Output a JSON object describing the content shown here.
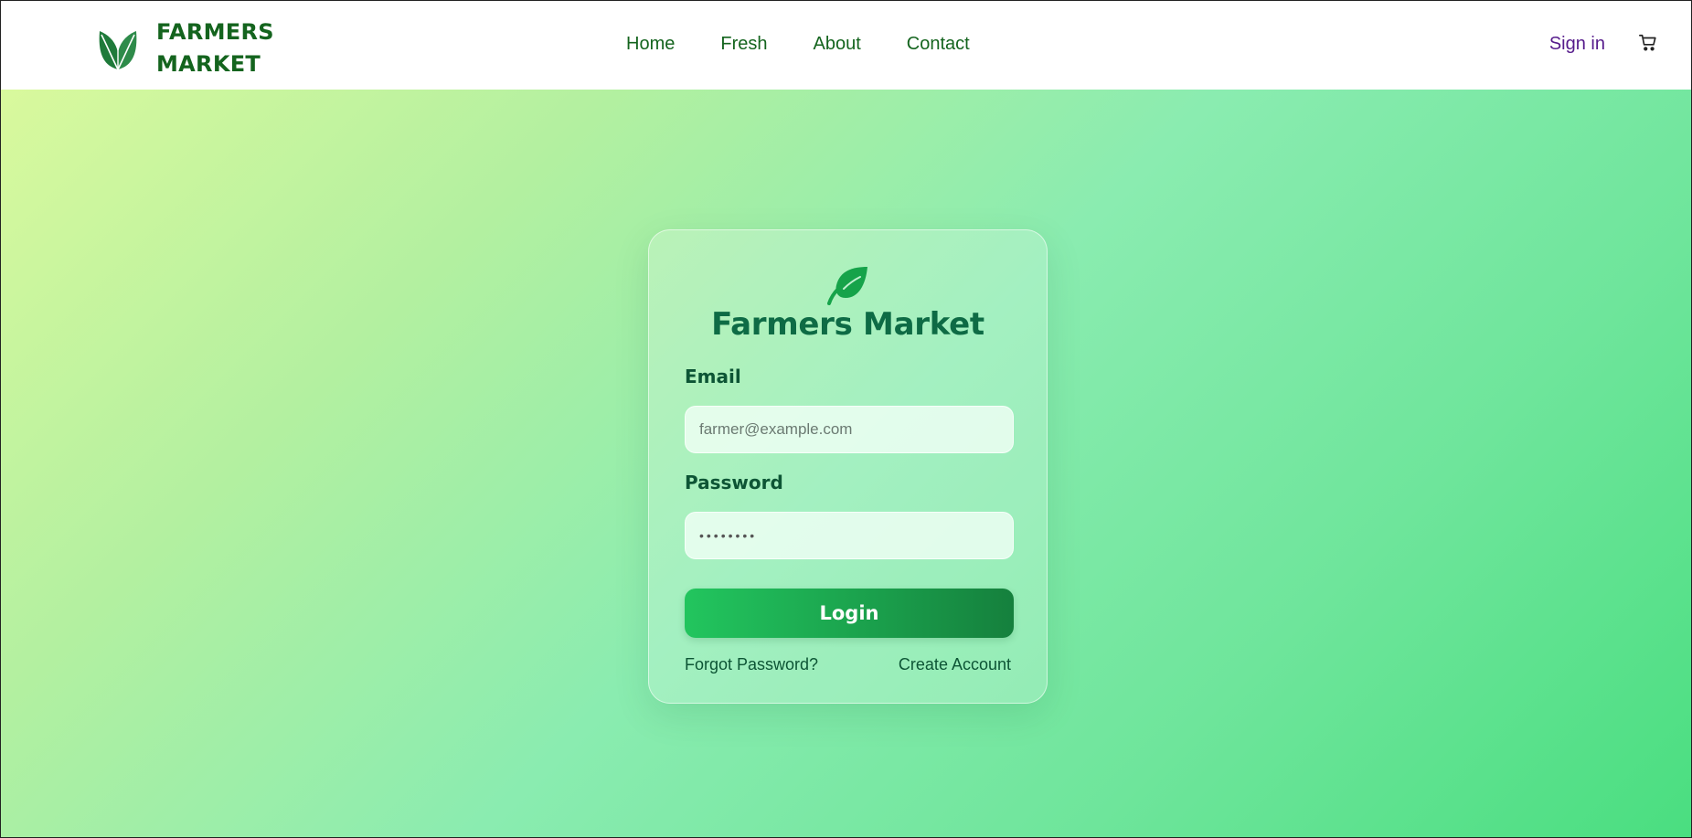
{
  "brand": {
    "line1": "FARMERS",
    "line2": "MARKET",
    "logo_icon": "leaves-icon"
  },
  "nav": {
    "links": [
      {
        "label": "Home"
      },
      {
        "label": "Fresh"
      },
      {
        "label": "About"
      },
      {
        "label": "Contact"
      }
    ],
    "signin_label": "Sign in",
    "cart_icon": "cart-icon"
  },
  "login": {
    "icon": "leaf-icon",
    "title": "Farmers Market",
    "email_label": "Email",
    "email_placeholder": "farmer@example.com",
    "password_label": "Password",
    "password_value": "••••••••",
    "login_label": "Login",
    "forgot_label": "Forgot Password?",
    "create_label": "Create Account"
  },
  "colors": {
    "brand_green": "#14641e",
    "title_green": "#0e6b45",
    "button_start": "#22c55e",
    "button_end": "#15803d",
    "signin_purple": "#551a8b"
  }
}
